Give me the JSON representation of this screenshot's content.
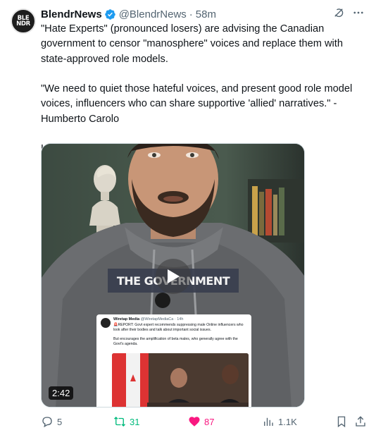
{
  "post": {
    "author": {
      "name": "BlendrNews",
      "handle": "@BlendrNews",
      "separator": "·",
      "time": "58m",
      "avatar_text": [
        "BLE",
        "NDR"
      ],
      "verified": true
    },
    "text": {
      "paragraph1": "\"Hate Experts\" (pronounced losers) are advising the Canadian government to censor \"manosphere\" voices and replace them with state-approved role models.",
      "paragraph2": "\"We need to quiet those hateful voices, and present good role model voices, influencers who can share supportive 'allied' narratives.\" - Humberto Carolo",
      "paragraph3": "Humberto, consider this an open letter...."
    },
    "media": {
      "overlay_caption": "THE GOVERNMENT",
      "duration": "2:42",
      "embedded_post": {
        "name": "Wiretap Media",
        "handle": "@WiretapMediaCa · 14h",
        "text1": "🚨REPORT: Govt expert recommends suppressing male Online influencers who look after their bodies and talk about important social issues.",
        "text2": "But encourages the amplification of beta males, who generally agree with the Govt's agenda."
      }
    },
    "actions": {
      "replies": "5",
      "reposts": "31",
      "likes": "87",
      "views": "1.1K"
    },
    "colors": {
      "verified": "#1d9bf0",
      "repost": "#00ba7c",
      "like": "#f91880",
      "muted": "#536471"
    },
    "icons": [
      "grok-icon",
      "more-icon",
      "reply-icon",
      "repost-icon",
      "like-icon",
      "views-icon",
      "bookmark-icon",
      "share-icon",
      "play-icon"
    ]
  }
}
